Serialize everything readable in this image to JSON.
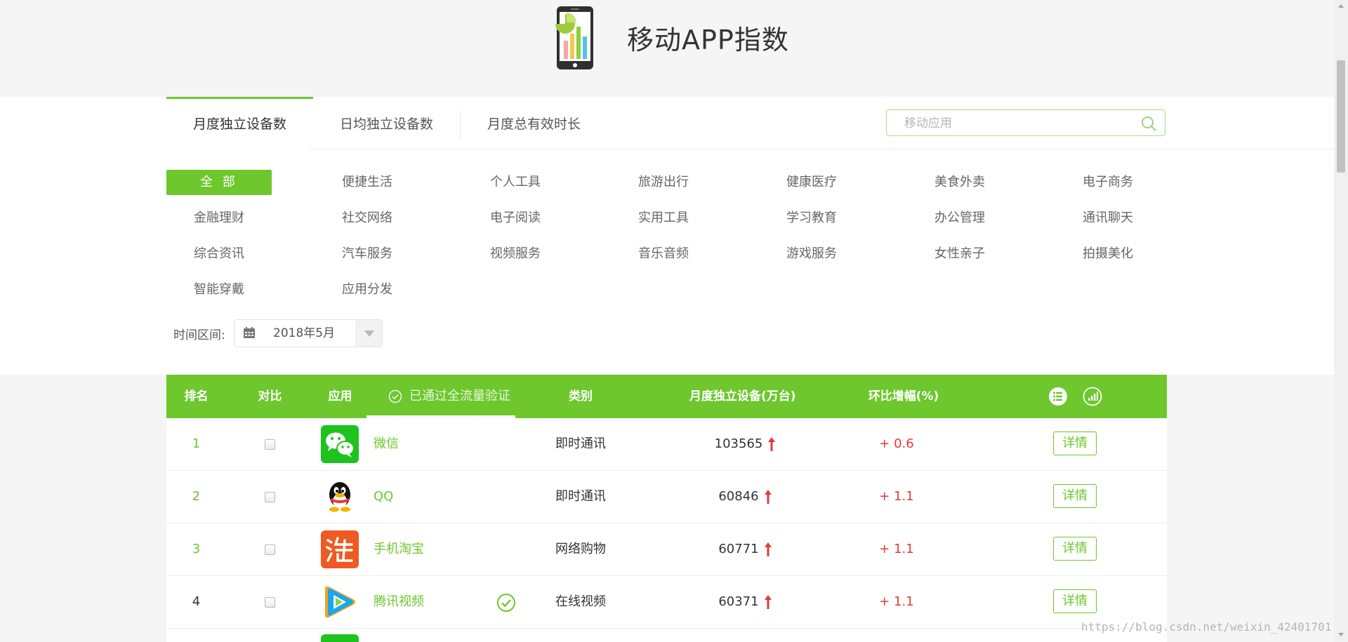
{
  "header": {
    "title": "移动APP指数"
  },
  "tabs": [
    {
      "label": "月度独立设备数",
      "active": true
    },
    {
      "label": "日均独立设备数",
      "active": false
    },
    {
      "label": "月度总有效时长",
      "active": false
    }
  ],
  "search": {
    "placeholder": "移动应用",
    "value": ""
  },
  "categories": [
    "全 部",
    "便捷生活",
    "个人工具",
    "旅游出行",
    "健康医疗",
    "美食外卖",
    "电子商务",
    "金融理财",
    "社交网络",
    "电子阅读",
    "实用工具",
    "学习教育",
    "办公管理",
    "通讯聊天",
    "综合资讯",
    "汽车服务",
    "视频服务",
    "音乐音频",
    "游戏服务",
    "女性亲子",
    "拍摄美化",
    "智能穿戴",
    "应用分发"
  ],
  "filter": {
    "time_label": "时间区间:",
    "date_value": "2018年5月"
  },
  "table": {
    "headers": {
      "rank": "排名",
      "compare": "对比",
      "app": "应用",
      "verified": "已通过全流量验证",
      "category": "类别",
      "devices": "月度独立设备(万台)",
      "change": "环比增幅(%)"
    },
    "detail_label": "详情",
    "rows": [
      {
        "rank": "1",
        "name": "微信",
        "icon": "wechat-icon",
        "verified": false,
        "category": "即时通讯",
        "devices": "103565",
        "trend": "up",
        "change": "+ 0.6"
      },
      {
        "rank": "2",
        "name": "QQ",
        "icon": "qq-penguin-icon",
        "verified": false,
        "category": "即时通讯",
        "devices": "60846",
        "trend": "up",
        "change": "+ 1.1"
      },
      {
        "rank": "3",
        "name": "手机淘宝",
        "icon": "taobao-icon",
        "verified": false,
        "category": "网络购物",
        "devices": "60771",
        "trend": "up",
        "change": "+ 1.1"
      },
      {
        "rank": "4",
        "name": "腾讯视频",
        "icon": "tencent-video-icon",
        "verified": true,
        "category": "在线视频",
        "devices": "60371",
        "trend": "up",
        "change": "+ 1.1"
      }
    ]
  },
  "watermark": "https://blog.csdn.net/weixin_42401701",
  "colors": {
    "accent": "#6dc72d",
    "up": "#e23a3a",
    "text": "#333333"
  }
}
